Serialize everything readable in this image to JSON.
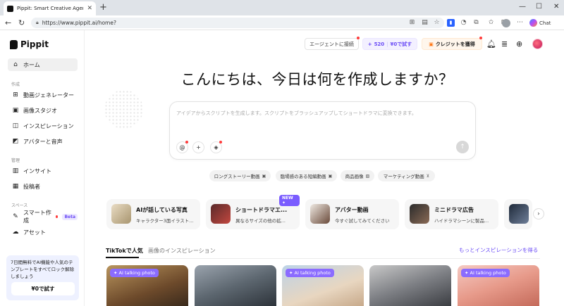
{
  "browser": {
    "tab_title": "Pippit: Smart Creative Agent for Si",
    "tab_close": "✕",
    "new_tab": "+",
    "url": "https://www.pippit.ai/home?",
    "chat_label": "Chat",
    "win_min": "—",
    "win_max": "☐",
    "win_close": "✕"
  },
  "sidebar": {
    "logo": "Pippit",
    "home": "ホーム",
    "section_create": "作成",
    "items_create": [
      "動画ジェネレーター",
      "画像スタジオ",
      "インスピレーション",
      "アバターと音声"
    ],
    "section_manage": "管理",
    "items_manage": [
      "インサイト",
      "投稿者"
    ],
    "section_space": "スペース",
    "smart_create": "スマート作成",
    "beta": "Beta",
    "asset": "アセット",
    "promo_text": "7日間無料でAI機能や人気のテンプレートをすべてロック解除しましょう",
    "promo_button": "¥0で試す"
  },
  "header": {
    "agent_connect": "エージェントに接続",
    "credits_plus": "+",
    "credits_count": "520",
    "credits_try": "¥0で試す",
    "earn_credits": "クレジットを獲得"
  },
  "hero": {
    "title": "こんにちは、今日は何を作成しますか？",
    "placeholder": "アイデアからスクリプトを生成します。スクリプトをブラッシュアップしてショートドラマに変換できます。",
    "btn_mention": "@",
    "btn_add": "+",
    "send": "↑"
  },
  "chips": [
    "ロングストーリー動画",
    "臨場感のある短編動画",
    "商品画像",
    "マーケティング動画"
  ],
  "features": [
    {
      "title": "AIが話している写真",
      "subtitle": "キャラクター3面イラスト..."
    },
    {
      "title": "ショートドラマエ...",
      "subtitle": "異なるサイズの他の拡...",
      "badge": "NEW ✦"
    },
    {
      "title": "アバター動画",
      "subtitle": "今すぐ試してみてください"
    },
    {
      "title": "ミニドラマ広告",
      "subtitle": "ハイドラマシーンに製品..."
    }
  ],
  "tabs": {
    "tiktok": "TikTokで人気",
    "image_inspiration": "画像のインスピレーション",
    "more_link": "もっとインスピレーションを得る"
  },
  "gallery": {
    "badge": "AI talking photo"
  },
  "colors": {
    "accent": "#6b4cf6",
    "badge": "#8b6cff",
    "red_dot": "#ff3b3b"
  }
}
